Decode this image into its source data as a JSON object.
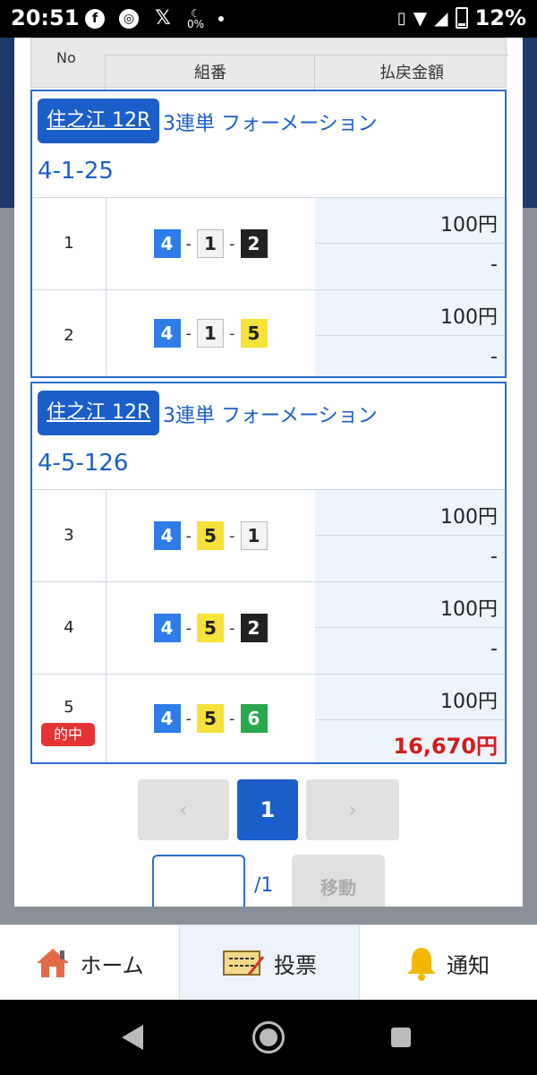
{
  "status_bar": {
    "time": "20:51",
    "icons": [
      "facebook-icon",
      "app-icon",
      "x-icon",
      "data-saver-icon",
      "dot-icon"
    ],
    "data_saver_label": "0%",
    "battery": "12%"
  },
  "table_header": {
    "no": "No",
    "combination": "組番",
    "payout": "払戻金額"
  },
  "tickets": [
    {
      "venue": "住之江 12R",
      "bet_type": "3連単 フォーメーション",
      "formation": "4-1-25",
      "rows": [
        {
          "no": "1",
          "boats": [
            "4",
            "1",
            "2"
          ],
          "bet": "100円",
          "payout": "-",
          "hit": false
        },
        {
          "no": "2",
          "boats": [
            "4",
            "1",
            "5"
          ],
          "bet": "100円",
          "payout": "-",
          "hit": false
        }
      ]
    },
    {
      "venue": "住之江 12R",
      "bet_type": "3連単 フォーメーション",
      "formation": "4-5-126",
      "rows": [
        {
          "no": "3",
          "boats": [
            "4",
            "5",
            "1"
          ],
          "bet": "100円",
          "payout": "-",
          "hit": false
        },
        {
          "no": "4",
          "boats": [
            "4",
            "5",
            "2"
          ],
          "bet": "100円",
          "payout": "-",
          "hit": false
        },
        {
          "no": "5",
          "boats": [
            "4",
            "5",
            "6"
          ],
          "bet": "100円",
          "payout": "16,670円",
          "hit": true,
          "hit_label": "的中"
        }
      ]
    }
  ],
  "pagination": {
    "prev": "‹",
    "current": "1",
    "next": "›",
    "input_value": "",
    "total": "/1",
    "move_label": "移動"
  },
  "bottom_nav": {
    "home": "ホーム",
    "vote": "投票",
    "notify": "通知"
  },
  "colors": {
    "primary": "#1b5ec9",
    "hit": "#d21d1d",
    "boat_1": "#f3f3f3",
    "boat_2": "#222222",
    "boat_4": "#2d7ce8",
    "boat_5": "#f7e13a",
    "boat_6": "#2aa84e"
  }
}
